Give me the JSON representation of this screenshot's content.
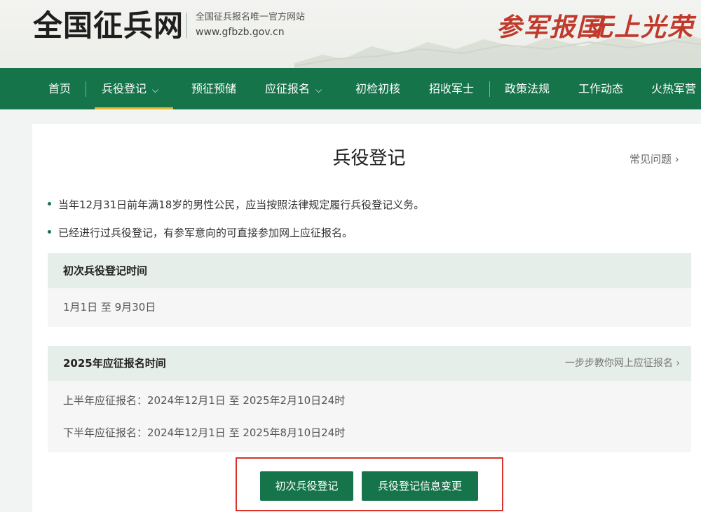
{
  "header": {
    "logo": "全国征兵网",
    "site_desc": "全国征兵报名唯一官方网站",
    "site_url": "www.gfbzb.gov.cn",
    "slogan_1": "参军报国",
    "slogan_2": "无上光荣"
  },
  "nav": {
    "items": [
      {
        "label": "首页"
      },
      {
        "label": "兵役登记",
        "has_dropdown": true,
        "active": true
      },
      {
        "label": "预征预储"
      },
      {
        "label": "应征报名",
        "has_dropdown": true
      },
      {
        "label": "初检初核"
      },
      {
        "label": "招收军士"
      },
      {
        "label": "政策法规"
      },
      {
        "label": "工作动态"
      },
      {
        "label": "火热军营"
      }
    ],
    "chevron": "⌵"
  },
  "main": {
    "title": "兵役登记",
    "faq_link": "常见问题 ›",
    "bullets": [
      "当年12月31日前年满18岁的男性公民，应当按照法律规定履行兵役登记义务。",
      "已经进行过兵役登记，有参军意向的可直接参加网上应征报名。"
    ],
    "panels": [
      {
        "title": "初次兵役登记时间",
        "rows": [
          "1月1日 至 9月30日"
        ]
      },
      {
        "title": "2025年应征报名时间",
        "link": "一步步教你网上应征报名 ›",
        "rows": [
          "上半年应征报名：2024年12月1日 至 2025年2月10日24时",
          "下半年应征报名：2024年12月1日 至 2025年8月10日24时"
        ]
      }
    ],
    "buttons": {
      "first_registration": "初次兵役登记",
      "info_change": "兵役登记信息变更"
    }
  },
  "colors": {
    "brand_green": "#16744a",
    "nav_active_underline": "#e4b631",
    "slogan_red": "#c0392b",
    "highlight_border": "#d9322b"
  }
}
